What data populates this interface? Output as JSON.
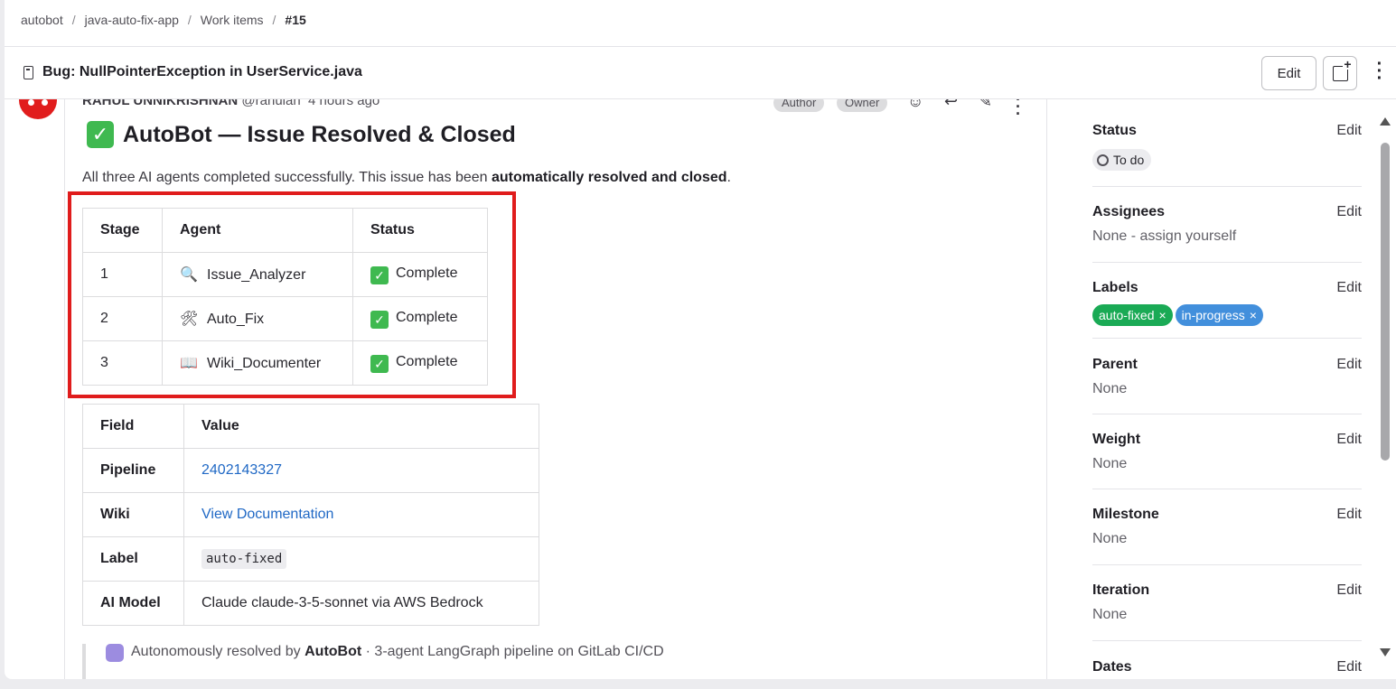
{
  "breadcrumb": {
    "items": [
      "autobot",
      "java-auto-fix-app",
      "Work items"
    ],
    "current": "#15",
    "separator": "/"
  },
  "header": {
    "title": "Bug: NullPointerException in UserService.java",
    "edit_label": "Edit"
  },
  "comment": {
    "author_name": "RAHUL UNNIKRISHNAN",
    "author_handle": "@rahulan",
    "time": "4 hours ago",
    "badges": [
      "Author",
      "Owner"
    ],
    "title": "AutoBot — Issue Resolved & Closed",
    "intro_prefix": "All three AI agents completed successfully. This issue has been ",
    "intro_bold": "automatically resolved and closed",
    "intro_suffix": ".",
    "stage_table": {
      "headers": [
        "Stage",
        "Agent",
        "Status"
      ],
      "rows": [
        {
          "stage": "1",
          "icon": "magnifier-icon",
          "agent": "Issue_Analyzer",
          "status": "Complete"
        },
        {
          "stage": "2",
          "icon": "tools-icon",
          "agent": "Auto_Fix",
          "status": "Complete"
        },
        {
          "stage": "3",
          "icon": "book-icon",
          "agent": "Wiki_Documenter",
          "status": "Complete"
        }
      ]
    },
    "field_table": {
      "headers": [
        "Field",
        "Value"
      ],
      "pipeline_label": "Pipeline",
      "pipeline_value": "2402143327",
      "wiki_label": "Wiki",
      "wiki_value": "View Documentation",
      "label_label": "Label",
      "label_value": "auto-fixed",
      "model_label": "AI Model",
      "model_value": "Claude claude-3-5-sonnet via AWS Bedrock"
    },
    "footer_prefix": "Autonomously resolved by ",
    "footer_bold": "AutoBot",
    "footer_suffix": " · 3-agent LangGraph pipeline on GitLab CI/CD"
  },
  "sidebar": {
    "edit_label": "Edit",
    "status": {
      "title": "Status",
      "value": "To do"
    },
    "assignees": {
      "title": "Assignees",
      "value": "None - assign yourself"
    },
    "labels": {
      "title": "Labels",
      "items": [
        {
          "name": "auto-fixed",
          "color": "#1aaa55"
        },
        {
          "name": "in-progress",
          "color": "#428fdc"
        }
      ]
    },
    "parent": {
      "title": "Parent",
      "value": "None"
    },
    "weight": {
      "title": "Weight",
      "value": "None"
    },
    "milestone": {
      "title": "Milestone",
      "value": "None"
    },
    "iteration": {
      "title": "Iteration",
      "value": "None"
    },
    "dates": {
      "title": "Dates"
    }
  },
  "colors": {
    "highlight_box": "#e01c1c",
    "link": "#1f68c5",
    "success": "#3fb950"
  }
}
